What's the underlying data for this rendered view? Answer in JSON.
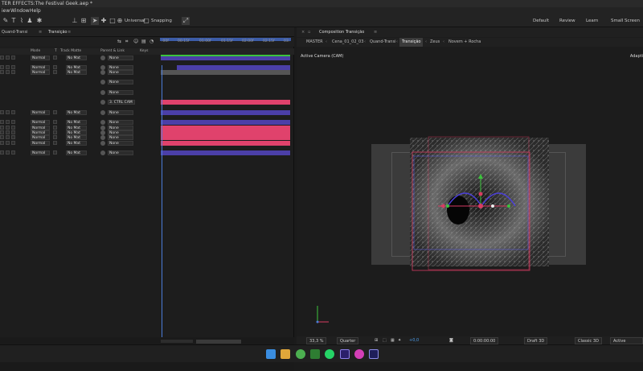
{
  "window_title": "TER EFFECTS:The Festival Geek.aep *",
  "menu": [
    "iew",
    "Window",
    "Help"
  ],
  "toolbar": {
    "universal": "Universal",
    "snapping": "Snapping"
  },
  "workspaces": [
    "Default",
    "Review",
    "Learn",
    "Small Screen"
  ],
  "timeline_tabs": [
    "Quand-Transi",
    "Transição"
  ],
  "ruler_ticks": [
    ":00f",
    "00:15f",
    "01:00f",
    "01:15f",
    "02:00f",
    "02:15f",
    "03:"
  ],
  "column_headers": {
    "mode": "Mode",
    "t": "T",
    "track_matte": "Track Matte",
    "parent": "Parent & Link",
    "keys": "Keys"
  },
  "layer_rows": [
    {
      "mode": "Normal",
      "matte": "No Mat",
      "parent": "None",
      "bar": "purple"
    },
    {
      "mode": "Normal",
      "matte": "No Mat",
      "parent": "None",
      "bar": "purple"
    },
    {
      "mode": "Normal",
      "matte": "No Mat",
      "parent": "None",
      "bar": "gray"
    },
    {
      "mode": "",
      "matte": "",
      "parent": "None",
      "bar": ""
    },
    {
      "mode": "",
      "matte": "",
      "parent": "None",
      "bar": ""
    },
    {
      "mode": "",
      "matte": "",
      "parent": "3. CTRL CAM",
      "bar": "pink"
    },
    {
      "mode": "Normal",
      "matte": "No Mat",
      "parent": "None",
      "bar": "purple"
    },
    {
      "mode": "Normal",
      "matte": "No Mat",
      "parent": "None",
      "bar": "purple"
    },
    {
      "mode": "Normal",
      "matte": "No Mat",
      "parent": "None",
      "bar": "pink"
    },
    {
      "mode": "Normal",
      "matte": "No Mat",
      "parent": "None",
      "bar": "pink"
    },
    {
      "mode": "Normal",
      "matte": "No Mat",
      "parent": "None",
      "bar": "pink"
    },
    {
      "mode": "Normal",
      "matte": "No Mat",
      "parent": "None",
      "bar": "pink"
    },
    {
      "mode": "Normal",
      "matte": "No Mat",
      "parent": "None",
      "bar": "purple"
    }
  ],
  "comp_title": "Composition Transição",
  "breadcrumbs": [
    "MASTER",
    "Cena_01_02_03",
    "Quand-Transi",
    "Transição",
    "Zeus",
    "Novem + Rocha"
  ],
  "active_breadcrumb": "Transição",
  "active_camera": "Active Camera (CAM)",
  "adaptive": "Adapti",
  "viewer_controls": {
    "zoom": "33,3 %",
    "quality": "Quarter",
    "timecode": "0:00:00:00",
    "plus": "+0,0",
    "draft3d": "Draft 3D",
    "renderer": "Classic 3D",
    "camera": "Active Came..."
  },
  "colors": {
    "purple": "#4b3fa8",
    "pink": "#e0426c",
    "blue": "#4b7bd8",
    "green": "#3cc43c"
  }
}
